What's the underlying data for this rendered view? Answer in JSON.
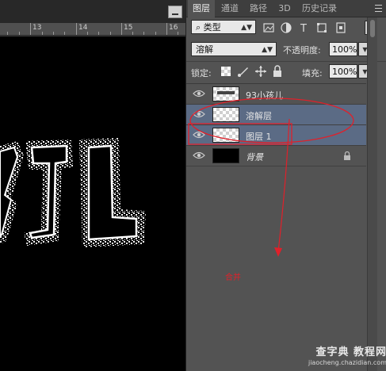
{
  "document": {
    "ruler_labels": [
      "13",
      "14",
      "15",
      "16"
    ]
  },
  "panel": {
    "tabs": [
      {
        "label": "图层",
        "active": true
      },
      {
        "label": "通道",
        "active": false
      },
      {
        "label": "路径",
        "active": false
      },
      {
        "label": "3D",
        "active": false
      },
      {
        "label": "历史记录",
        "active": false
      }
    ],
    "filter": {
      "kind_label": "类型",
      "icons": [
        "image-filter-icon",
        "adjustment-filter-icon",
        "type-filter-icon",
        "shape-filter-icon",
        "smart-object-filter-icon"
      ]
    },
    "blend": {
      "mode": "溶解",
      "opacity_label": "不透明度:",
      "opacity_value": "100%"
    },
    "lock": {
      "label": "锁定:",
      "icons": [
        "lock-transparent-icon",
        "lock-paint-icon",
        "lock-move-icon",
        "lock-all-icon"
      ],
      "fill_label": "填充:",
      "fill_value": "100%"
    },
    "layers": [
      {
        "name": "93小孩儿",
        "visible": true,
        "selected": false,
        "thumb": "text"
      },
      {
        "name": "溶解层",
        "visible": true,
        "selected": true,
        "thumb": "transparent"
      },
      {
        "name": "图层 1",
        "visible": true,
        "selected": true,
        "thumb": "transparent"
      },
      {
        "name": "背景",
        "visible": true,
        "selected": false,
        "thumb": "black",
        "locked": true
      }
    ]
  },
  "annotation": {
    "text": "合并",
    "color": "#e0202a"
  },
  "watermark": {
    "line1": "查字典 教程网",
    "line2": "jiaocheng.chazidian.com"
  },
  "colors": {
    "panel_bg": "#535353",
    "selection": "#5b6b85",
    "annotation_red": "#e0202a"
  }
}
